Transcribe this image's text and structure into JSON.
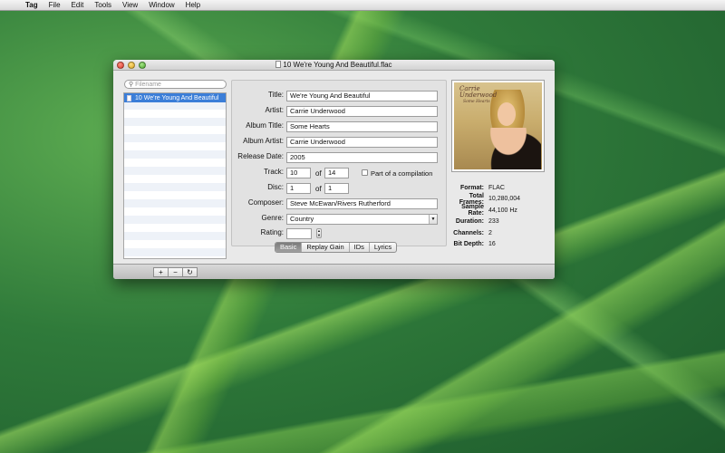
{
  "menubar": {
    "apple_icon": "apple-icon",
    "app_name": "Tag",
    "items": [
      "File",
      "Edit",
      "Tools",
      "View",
      "Window",
      "Help"
    ]
  },
  "window": {
    "title": "10 We're Young And Beautiful.flac"
  },
  "sidebar": {
    "search_placeholder": "Filename",
    "files": [
      "10 We're Young And Beautiful"
    ]
  },
  "form": {
    "title_label": "Title:",
    "title_value": "We're Young And Beautiful",
    "artist_label": "Artist:",
    "artist_value": "Carrie Underwood",
    "album_title_label": "Album Title:",
    "album_title_value": "Some Hearts",
    "album_artist_label": "Album Artist:",
    "album_artist_value": "Carrie Underwood",
    "release_date_label": "Release Date:",
    "release_date_value": "2005",
    "track_label": "Track:",
    "track_value": "10",
    "track_total": "14",
    "of_label": "of",
    "compilation_label": "Part of a compilation",
    "disc_label": "Disc:",
    "disc_value": "1",
    "disc_total": "1",
    "composer_label": "Composer:",
    "composer_value": "Steve McEwan/Rivers Rutherford",
    "genre_label": "Genre:",
    "genre_value": "Country",
    "rating_label": "Rating:",
    "rating_value": ""
  },
  "tabs": [
    {
      "label": "Basic",
      "active": true
    },
    {
      "label": "Replay Gain",
      "active": false
    },
    {
      "label": "IDs",
      "active": false
    },
    {
      "label": "Lyrics",
      "active": false
    }
  ],
  "artwork": {
    "title_line1": "Carrie",
    "title_line2": "Underwood",
    "subtitle": "Some Hearts"
  },
  "info": {
    "format_label": "Format:",
    "format_value": "FLAC",
    "total_frames_label": "Total Frames:",
    "total_frames_value": "10,280,004",
    "sample_rate_label": "Sample Rate:",
    "sample_rate_value": "44,100 Hz",
    "duration_label": "Duration:",
    "duration_value": "233",
    "channels_label": "Channels:",
    "channels_value": "2",
    "bit_depth_label": "Bit Depth:",
    "bit_depth_value": "16"
  },
  "bottombar": {
    "add": "+",
    "remove": "−",
    "refresh": "↻"
  }
}
